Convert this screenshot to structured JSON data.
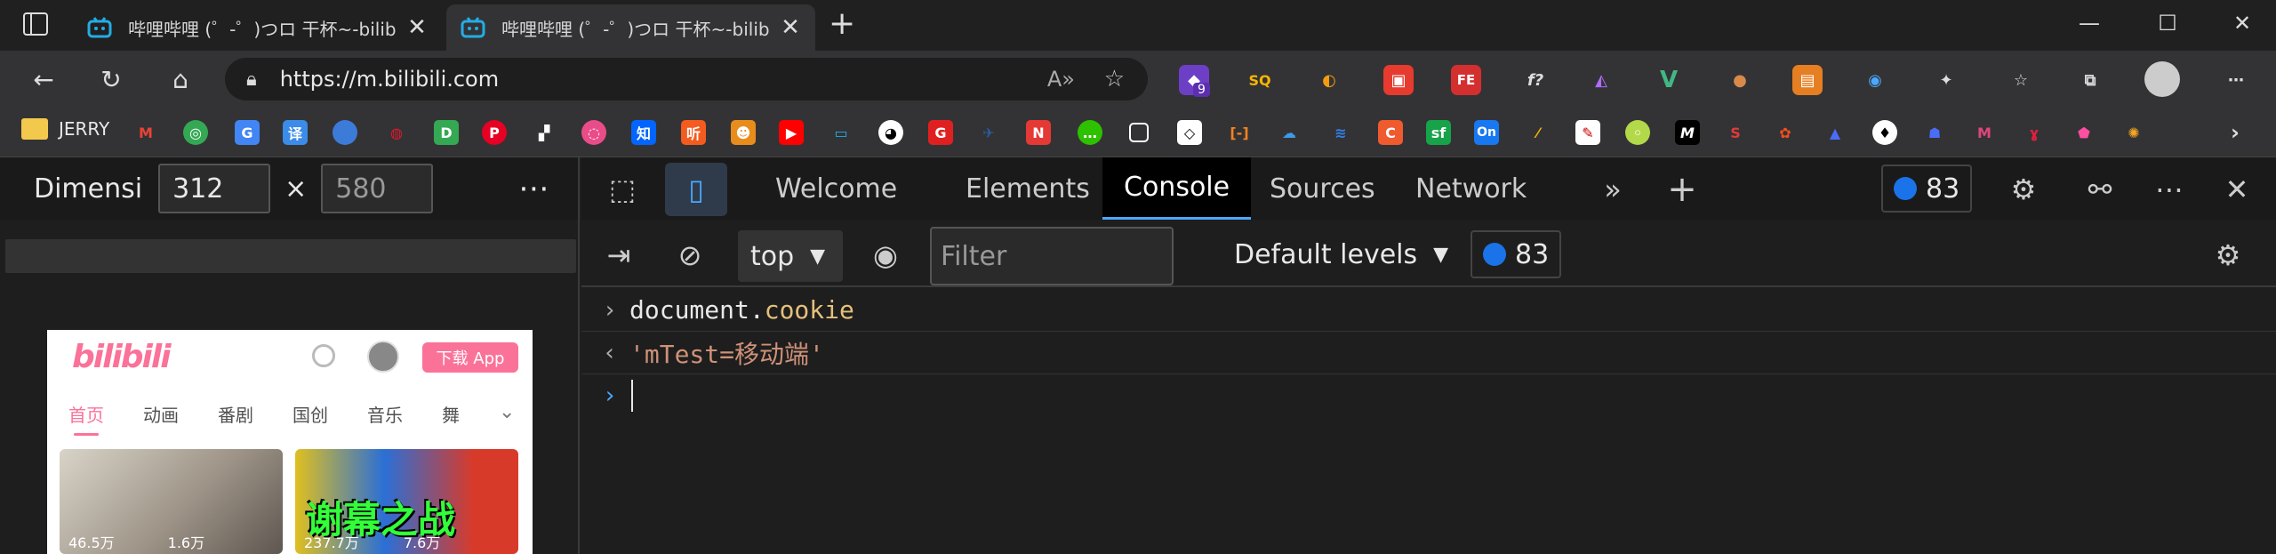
{
  "browser": {
    "tabs": [
      {
        "title": "哔哩哔哩 (゜-゜)つロ 干杯~-bilibili",
        "active": false
      },
      {
        "title": "哔哩哔哩 (゜-゜)つロ 干杯~-bilibili",
        "active": true
      }
    ],
    "new_tab_label": "+",
    "address": "https://m.bilibili.com",
    "bookmarks": [
      {
        "label": "JERRY",
        "icon": "folder-icon"
      }
    ],
    "extension_badge": "9"
  },
  "device_toolbar": {
    "dimensions_label": "Dimensi",
    "width": "312",
    "height": "580",
    "times": "×",
    "more": "⋯"
  },
  "mobile_page": {
    "logo": "bilibili",
    "download_button": "下载 App",
    "nav": [
      "首页",
      "动画",
      "番剧",
      "国创",
      "音乐",
      "舞"
    ],
    "thumbnail_caption": "谢幕之战",
    "stats_left": "46.5万",
    "stats_right": "1.6万",
    "stats_left2": "237.7万",
    "stats_right2": "7.6万"
  },
  "devtools": {
    "tabs": [
      "Welcome",
      "Elements",
      "Console",
      "Sources",
      "Network"
    ],
    "active_tab": "Console",
    "issues_count": "83",
    "context": "top",
    "filter_placeholder": "Filter",
    "levels": "Default levels",
    "toolbar_count": "83"
  },
  "console": {
    "input_obj": "document.",
    "input_prop": "cookie",
    "output": "'mTest=移动端'"
  },
  "colors": {
    "accent": "#4aa8ff",
    "bilibili_pink": "#fb7299",
    "message_blue": "#1a73e8"
  }
}
